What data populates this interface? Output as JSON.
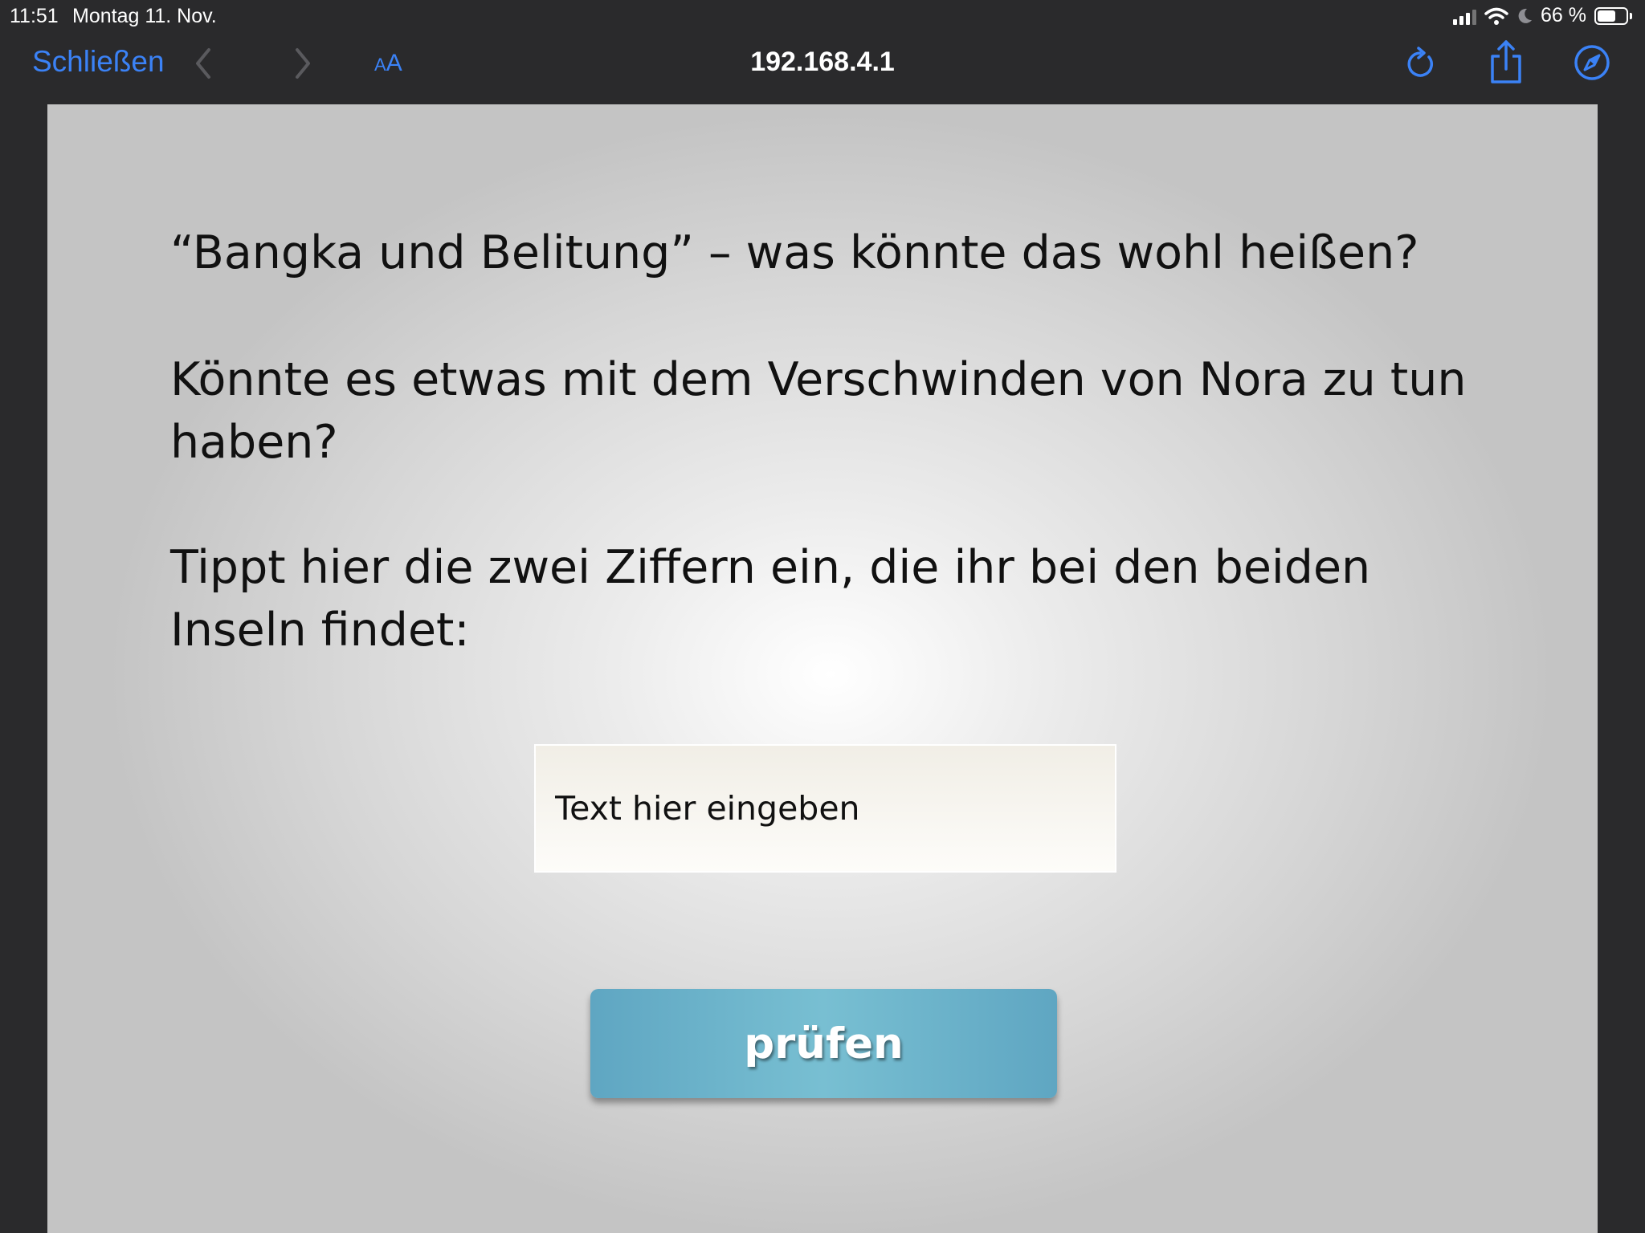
{
  "status_bar": {
    "time": "11:51",
    "date": "Montag 11. Nov.",
    "battery": "66 %",
    "battery_level": 0.66,
    "icons": [
      "signal-icon",
      "wifi-icon",
      "moon-icon",
      "battery-icon"
    ]
  },
  "toolbar": {
    "close_label": "Schließen",
    "aa_small": "A",
    "aa_big": "A",
    "url": "192.168.4.1",
    "accent": "#3b82f6",
    "icons": [
      "back-icon",
      "forward-icon",
      "reload-icon",
      "share-icon",
      "compass-icon"
    ]
  },
  "page": {
    "paragraph1": "“Bangka und Belitung” – was könnte das wohl heißen?",
    "paragraph2": "Könnte es etwas mit dem Verschwinden von Nora zu tun haben?",
    "paragraph3": "Tippt hier die zwei Ziffern ein, die ihr bei den beiden Inseln findet:",
    "input": {
      "placeholder": "Text hier eingeben",
      "value": ""
    },
    "button_label": "prüfen",
    "button_color": "#6ab3ca"
  }
}
